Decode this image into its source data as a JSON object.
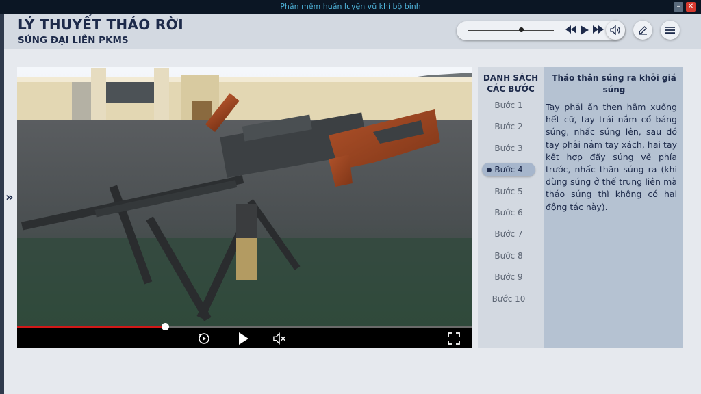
{
  "window": {
    "title": "Phần mềm huấn luyện vũ khí bộ binh",
    "minimize_icon": "minimize-icon",
    "close_icon": "close-icon"
  },
  "header": {
    "title": "LÝ THUYẾT THÁO RỜI",
    "subtitle": "SÚNG ĐẠI LIÊN PKMS"
  },
  "audio": {
    "volume_fraction": 0.62,
    "icons": [
      "rewind-icon",
      "play-icon",
      "fast-forward-icon",
      "speaker-icon",
      "edit-icon",
      "menu-icon"
    ]
  },
  "video": {
    "progress_fraction": 0.325,
    "icons": [
      "replay-icon",
      "play-icon",
      "mute-icon",
      "fullscreen-icon"
    ]
  },
  "steps": {
    "title": "DANH SÁCH CÁC BƯỚC",
    "active_index": 3,
    "items": [
      "Bước 1",
      "Bước 2",
      "Bước 3",
      "Bước 4",
      "Bước 5",
      "Bước 6",
      "Bước 7",
      "Bước 8",
      "Bước 9",
      "Bước 10"
    ]
  },
  "description": {
    "title": "Tháo thân súng ra khỏi giá súng",
    "body": "Tay phải ấn then hãm xuống hết cữ, tay trái nắm cổ báng súng, nhấc súng lên, sau đó tay phải nắm tay xách, hai tay kết hợp đẩy súng về phía trước, nhấc thân súng ra (khi dùng súng ở thế trung liên mà tháo súng thì không có hai động tác này)."
  },
  "colors": {
    "accent_red": "#d01818",
    "navy": "#1d2a4a",
    "titlebar_text": "#4fb3d9"
  }
}
